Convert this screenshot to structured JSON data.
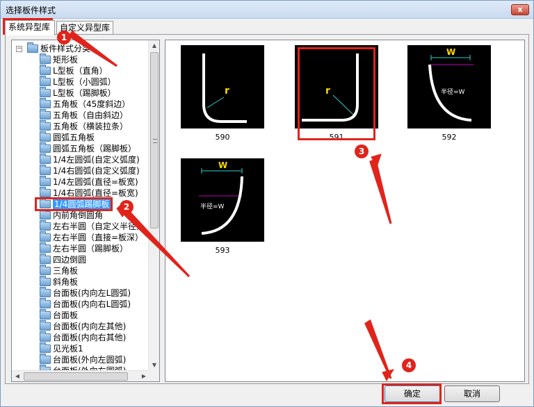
{
  "window": {
    "title": "选择板件样式",
    "close_glyph": "x"
  },
  "tabs": [
    {
      "label": "系统异型库",
      "active": true
    },
    {
      "label": "自定义异型库",
      "active": false
    }
  ],
  "tree": {
    "root_label": "板件样式分类",
    "items": [
      "矩形板",
      "L型板（直角）",
      "L型板（小圆弧）",
      "L型板（踢脚板）",
      "五角板（45度斜边）",
      "五角板（自由斜边）",
      "五角板（横装拉条）",
      "圆弧五角板",
      "圆弧五角板（踢脚板）",
      "1/4左圆弧(自定义弧度)",
      "1/4右圆弧(自定义弧度)",
      "1/4左圆弧(直径=板宽)",
      "1/4右圆弧(直径=板宽)",
      "1/4圆弧踢脚板",
      "内前角倒圆角",
      "左右半圆（自定义半径）",
      "左右半圆（直接=板深）",
      "左右半圆（踢脚板）",
      "四边倒圆",
      "三角板",
      "斜角板",
      "台面板(内向左L圆弧)",
      "台面板(内向右L圆弧)",
      "台面板",
      "台面板(内向左其他)",
      "台面板(内向右其他)",
      "见光板1",
      "台面板(外向左圆弧)",
      "台面板(外向右圆弧)"
    ],
    "selected_index": 13
  },
  "thumbnails": [
    {
      "id": "590",
      "variant": "l-curve-small"
    },
    {
      "id": "591",
      "variant": "l-curve-large"
    },
    {
      "id": "592",
      "variant": "quarter-left",
      "w_label": "W",
      "radius_label": "半径=W"
    },
    {
      "id": "593",
      "variant": "quarter-right",
      "w_label": "W",
      "radius_label": "半径=W"
    }
  ],
  "buttons": {
    "ok": "确定",
    "cancel": "取消"
  },
  "annotations": [
    "1",
    "2",
    "3",
    "4"
  ],
  "colors": {
    "accent": "#e0241b",
    "selection": "#3399ff"
  }
}
